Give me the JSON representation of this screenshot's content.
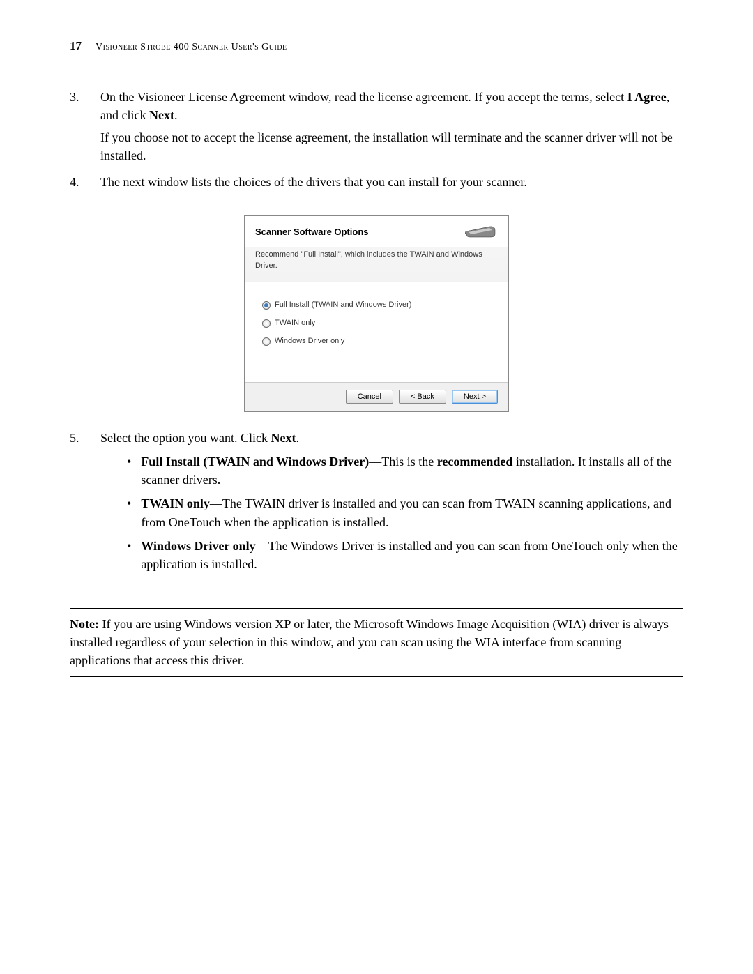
{
  "header": {
    "page_number": "17",
    "guide_title": "Visioneer Strobe 400 Scanner User's Guide"
  },
  "steps": {
    "step3": {
      "number": "3.",
      "text_pre": "On the Visioneer License Agreement window, read the license agreement. If you accept the terms, select ",
      "i_agree": "I Agree",
      "text_mid": ", and click ",
      "next": "Next",
      "text_post": ".",
      "para2": "If you choose not to accept the license agreement, the installation will terminate and the scanner driver will not be installed."
    },
    "step4": {
      "number": "4.",
      "text": "The next window lists the choices of the drivers that you can install for your scanner."
    },
    "step5": {
      "number": "5.",
      "text_pre": "Select the option you want. Click ",
      "next": "Next",
      "text_post": ".",
      "bullets": {
        "b1": {
          "title": "Full Install (TWAIN and Windows Driver)",
          "text_mid": "—This is the ",
          "recommended": "recommended",
          "text_post": " installation. It installs all of the scanner drivers."
        },
        "b2": {
          "title": "TWAIN only",
          "text": "—The TWAIN driver is installed and you can scan from TWAIN scanning applications, and from OneTouch when the application is installed."
        },
        "b3": {
          "title": "Windows Driver only",
          "text": "—The Windows Driver is installed and you can scan from OneTouch only when the application is installed."
        }
      }
    }
  },
  "dialog": {
    "title": "Scanner Software Options",
    "description": "Recommend \"Full Install\", which includes the TWAIN  and Windows Driver.",
    "options": {
      "opt1": "Full Install (TWAIN and Windows Driver)",
      "opt2": "TWAIN only",
      "opt3": "Windows Driver only"
    },
    "buttons": {
      "cancel": "Cancel",
      "back": "< Back",
      "next": "Next >"
    }
  },
  "note": {
    "label": "Note:",
    "text": " If you are using Windows version XP or later, the Microsoft Windows Image Acquisition (WIA) driver is always installed regardless of your selection in this window, and you can scan using the WIA interface from scanning applications that access this driver."
  }
}
